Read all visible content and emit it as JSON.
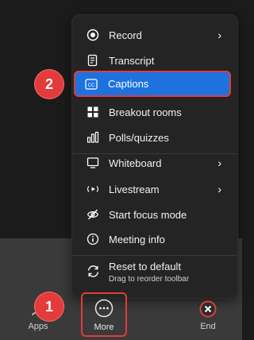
{
  "menu": {
    "items": [
      {
        "label": "Record",
        "icon": "record-icon",
        "submenu": true
      },
      {
        "label": "Transcript",
        "icon": "transcript-icon",
        "submenu": false
      },
      {
        "label": "Captions",
        "icon": "captions-icon",
        "submenu": false,
        "highlighted": true
      },
      {
        "label": "Breakout rooms",
        "icon": "breakout-rooms-icon",
        "submenu": false
      },
      {
        "label": "Polls/quizzes",
        "icon": "polls-icon",
        "submenu": false
      },
      {
        "label": "Whiteboard",
        "icon": "whiteboard-icon",
        "submenu": true
      },
      {
        "label": "Livestream",
        "icon": "livestream-icon",
        "submenu": true
      },
      {
        "label": "Start focus mode",
        "icon": "focus-mode-icon",
        "submenu": false
      },
      {
        "label": "Meeting info",
        "icon": "info-icon",
        "submenu": false
      }
    ],
    "reset": {
      "label": "Reset to default",
      "sub": "Drag to reorder toolbar",
      "icon": "reset-icon"
    },
    "chevron": "›"
  },
  "toolbar": {
    "apps_label": "Apps",
    "more_label": "More",
    "end_label": "End"
  },
  "annotations": {
    "step1": "1",
    "step2": "2"
  },
  "colors": {
    "highlight": "#1e72e0",
    "annotation_red": "#e33b3b",
    "menu_bg": "#242424"
  }
}
